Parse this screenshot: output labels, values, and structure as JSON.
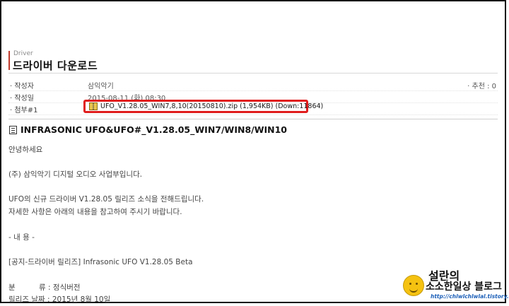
{
  "post": {
    "category": "Driver",
    "title": "드라이버 다운로드",
    "heading": "INFRASONIC UFO&UFO#_V1.28.05_WIN7/WIN8/WIN10"
  },
  "meta": {
    "author_label": "· 작성자",
    "author_value": "삼익악기",
    "date_label": "· 작성일",
    "date_value": "2015-08-11 (화) 08:30",
    "attach_label": "· 첨부#1",
    "attach_file": "UFO_V1.28.05_WIN7,8,10(20150810).zip (1,954KB) (Down:11864)",
    "recommend_label": "· 추천 : 0"
  },
  "body": {
    "lines": [
      "안녕하세요",
      "(주) 삼익악기 디지털 오디오 사업부입니다.",
      "UFO의 신규 드라이버 V1.28.05 릴리즈 소식을 전해드립니다.",
      "자세한 사항은 아래의 내용을 참고하여 주시기 바랍니다.",
      "- 내 용 -",
      "[공지-드라이버 릴리즈] Infrasonic UFO V1.28.05 Beta",
      "분          류 : 정식버전",
      "릴리즈 날짜 : 2015년 8월 10일"
    ]
  },
  "watermark": {
    "title": "설란의",
    "subtitle": "소소한일상 블로그",
    "url": "http://chlwlchlwlal.tistory.com",
    "icon": "smiley-icon"
  },
  "colors": {
    "highlight_box": "#e01d1d",
    "title_accent": "#c0392b",
    "watermark_url": "#1c5fb8"
  }
}
